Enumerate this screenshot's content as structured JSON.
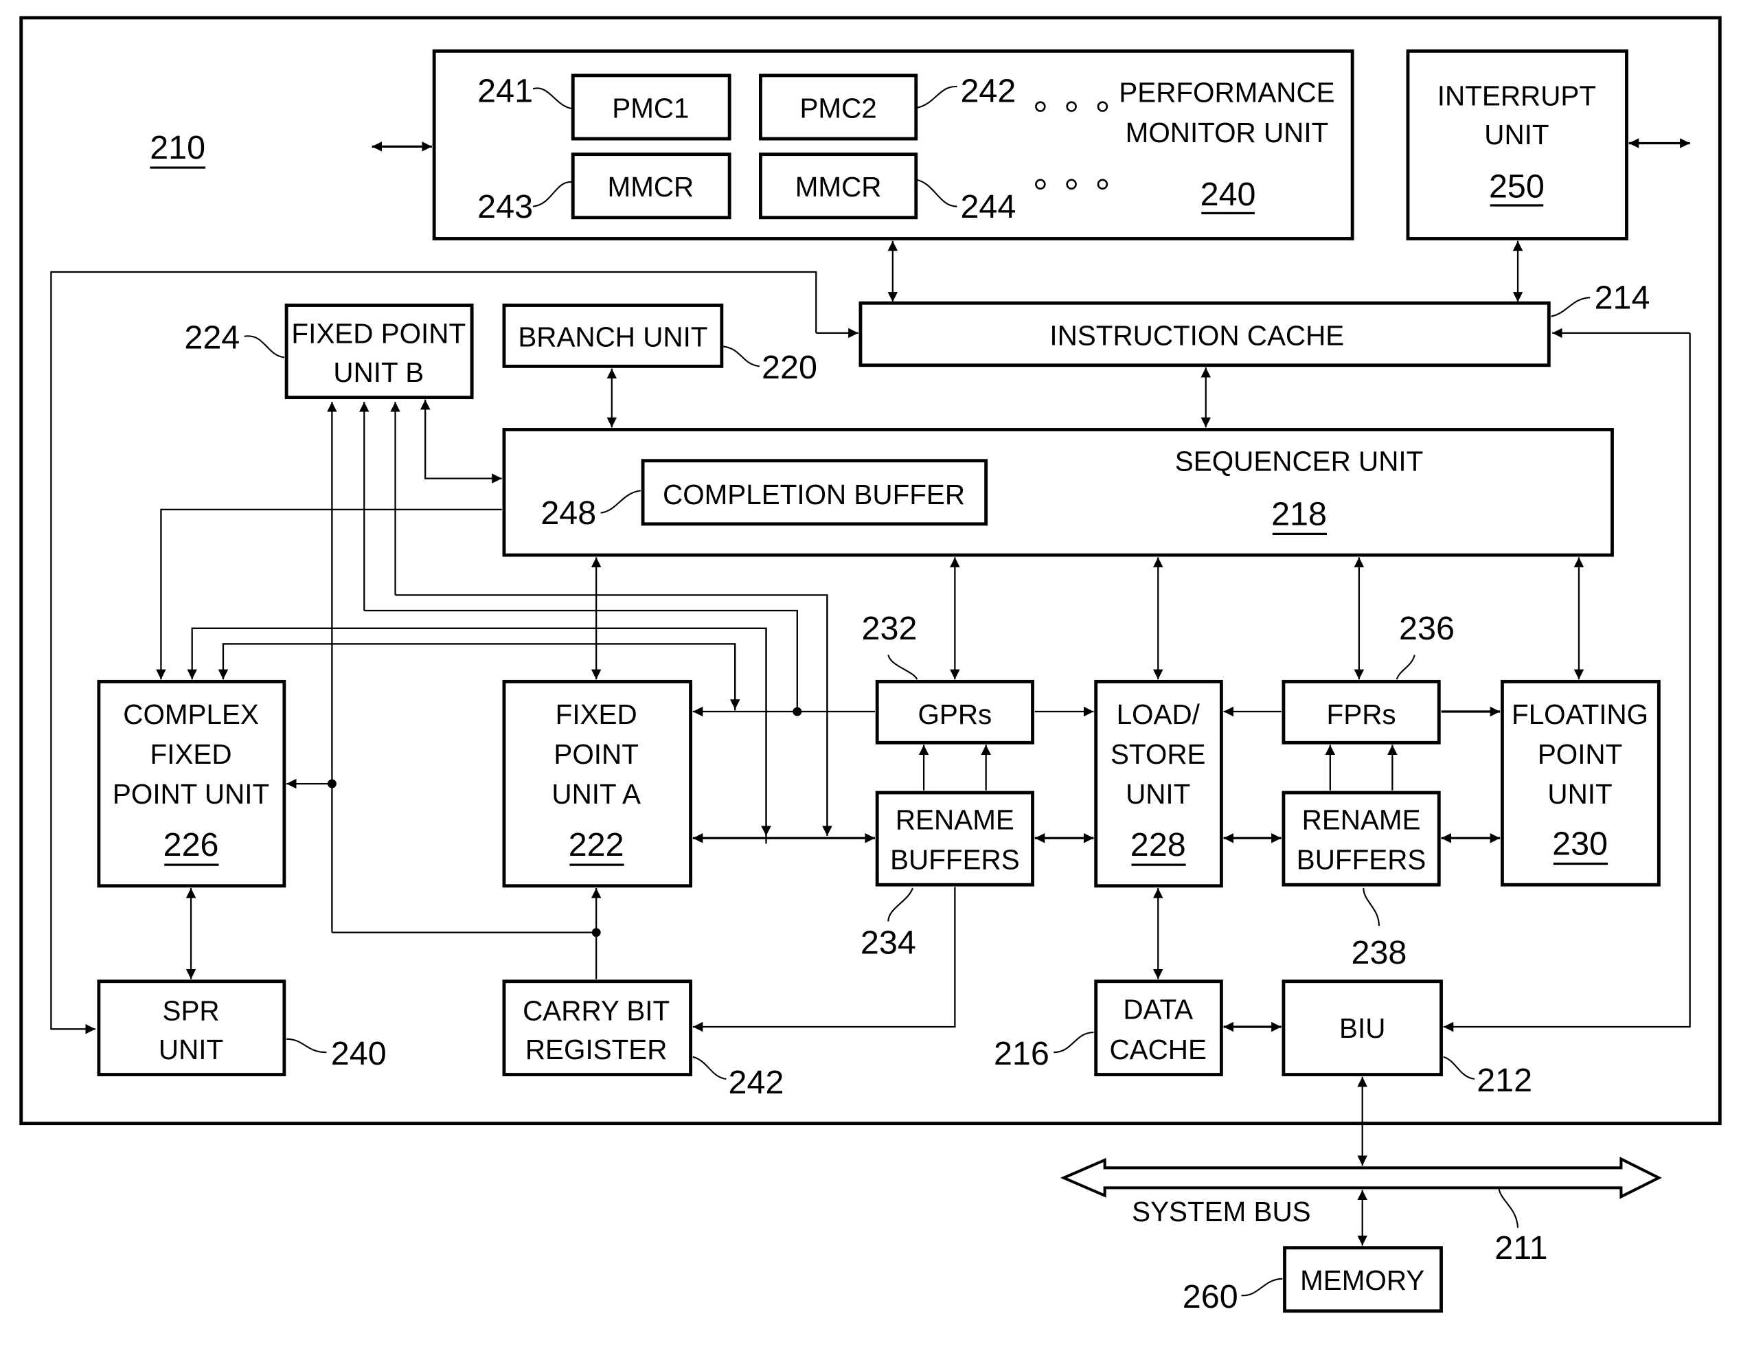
{
  "diagram": {
    "processor_ref": "210",
    "units": {
      "pmu": {
        "lines": [
          "PERFORMANCE",
          "MONITOR UNIT"
        ],
        "ref": "240"
      },
      "pmc1": {
        "label": "PMC1",
        "ref": "241"
      },
      "pmc2": {
        "label": "PMC2",
        "ref": "242"
      },
      "mmcr1": {
        "label": "MMCR",
        "ref": "243"
      },
      "mmcr2": {
        "label": "MMCR",
        "ref": "244"
      },
      "interrupt": {
        "lines": [
          "INTERRUPT",
          "UNIT"
        ],
        "ref": "250"
      },
      "icache": {
        "label": "INSTRUCTION CACHE",
        "ref": "214"
      },
      "branch": {
        "label": "BRANCH UNIT",
        "ref": "220"
      },
      "fxub": {
        "lines": [
          "FIXED POINT",
          "UNIT B"
        ],
        "ref": "224"
      },
      "sequencer": {
        "label": "SEQUENCER UNIT",
        "ref": "218"
      },
      "completion": {
        "label": "COMPLETION BUFFER",
        "ref": "248"
      },
      "cfxu": {
        "lines": [
          "COMPLEX",
          "FIXED",
          "POINT UNIT"
        ],
        "ref": "226"
      },
      "fxua": {
        "lines": [
          "FIXED",
          "POINT",
          "UNIT A"
        ],
        "ref": "222"
      },
      "gprs": {
        "label": "GPRs",
        "ref": "232"
      },
      "gpr_rename": {
        "lines": [
          "RENAME",
          "BUFFERS"
        ],
        "ref": "234"
      },
      "lsu": {
        "lines": [
          "LOAD/",
          "STORE",
          "UNIT"
        ],
        "ref": "228"
      },
      "fprs": {
        "label": "FPRs",
        "ref": "236"
      },
      "fpr_rename": {
        "lines": [
          "RENAME",
          "BUFFERS"
        ],
        "ref": "238"
      },
      "fpu": {
        "lines": [
          "FLOATING",
          "POINT",
          "UNIT"
        ],
        "ref": "230"
      },
      "spr": {
        "lines": [
          "SPR",
          "UNIT"
        ],
        "ref": "240"
      },
      "carry": {
        "lines": [
          "CARRY BIT",
          "REGISTER"
        ],
        "ref": "242"
      },
      "dcache": {
        "lines": [
          "DATA",
          "CACHE"
        ],
        "ref": "216"
      },
      "biu": {
        "label": "BIU",
        "ref": "212"
      },
      "sysbus": {
        "label": "SYSTEM BUS",
        "ref": "211"
      },
      "memory": {
        "label": "MEMORY",
        "ref": "260"
      }
    }
  }
}
